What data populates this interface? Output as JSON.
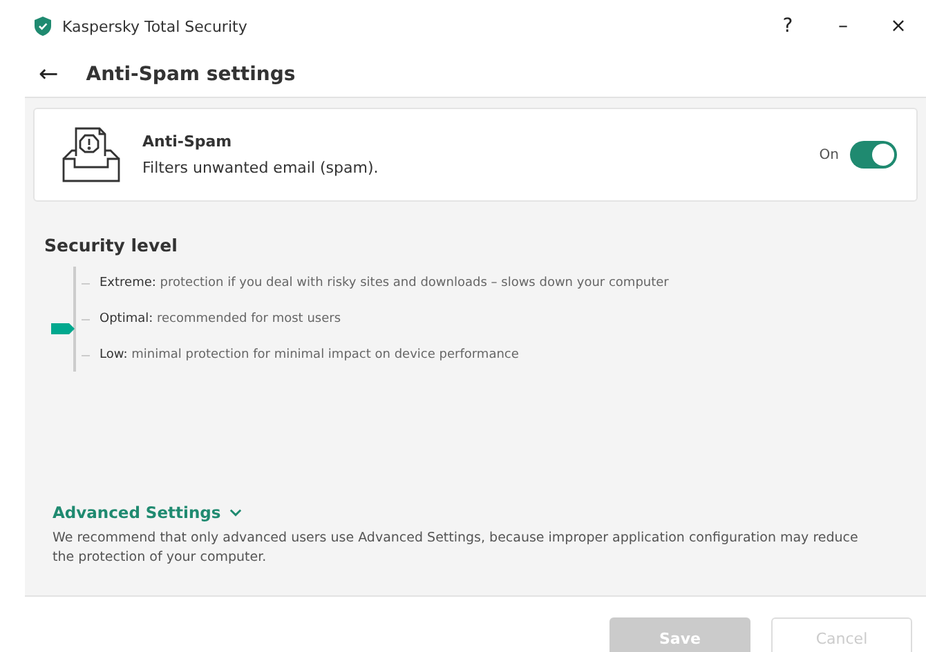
{
  "window": {
    "title": "Kaspersky Total Security",
    "controls": [
      "?",
      "–",
      "×"
    ]
  },
  "header": {
    "back": "←",
    "title": "Anti-Spam settings"
  },
  "component": {
    "name": "Anti-Spam",
    "description": "Filters unwanted email (spam).",
    "switch_label": "On",
    "on": true
  },
  "security_level": {
    "title": "Security level",
    "levels": [
      {
        "name": "Extreme:",
        "description": "protection if you deal with risky sites and downloads – slows down your computer",
        "selected": false
      },
      {
        "name": "Optimal:",
        "description": "recommended for most users",
        "selected": true
      },
      {
        "name": "Low:",
        "description": "minimal protection for minimal impact on device performance",
        "selected": false
      }
    ]
  },
  "advanced": {
    "label": "Advanced Settings",
    "note": "We recommend that only advanced users use Advanced Settings, because improper application configuration may reduce the protection of your computer."
  },
  "buttons": [
    {
      "label": "Save",
      "kind": "primary",
      "disabled": true
    },
    {
      "label": "Cancel",
      "kind": "secondary",
      "disabled": true
    }
  ]
}
